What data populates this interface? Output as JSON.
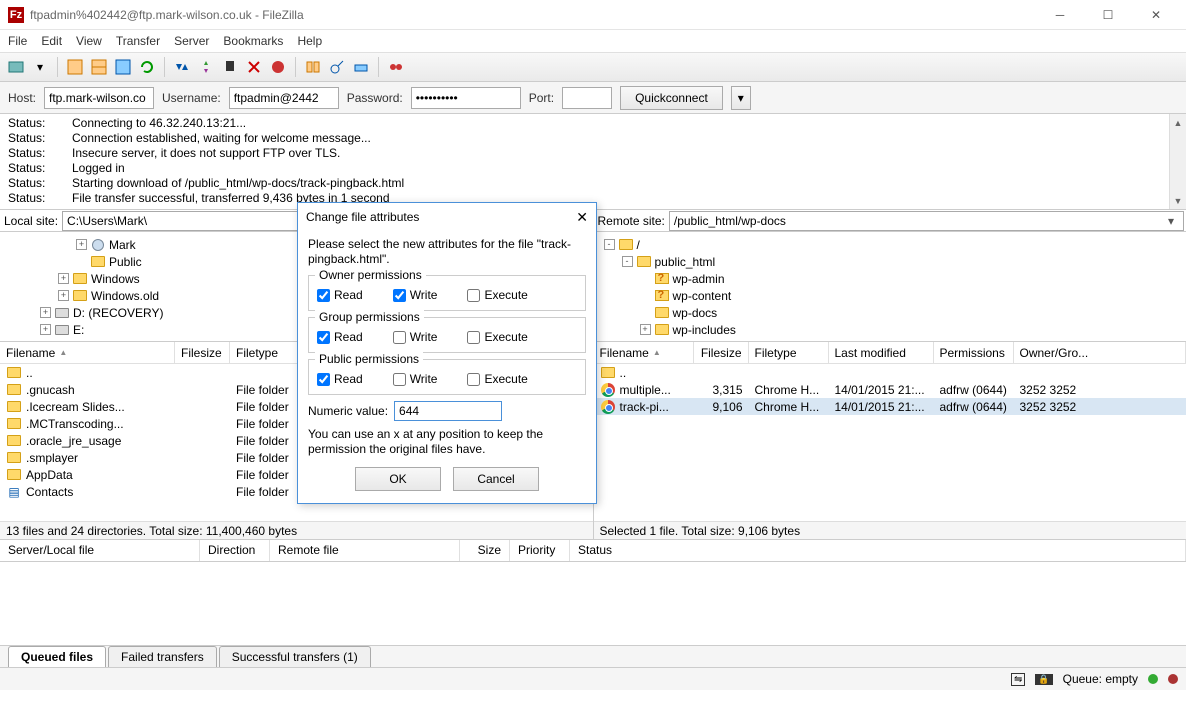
{
  "window": {
    "title": "ftpadmin%402442@ftp.mark-wilson.co.uk - FileZilla"
  },
  "menu": [
    "File",
    "Edit",
    "View",
    "Transfer",
    "Server",
    "Bookmarks",
    "Help"
  ],
  "conn": {
    "host_label": "Host:",
    "host": "ftp.mark-wilson.co",
    "user_label": "Username:",
    "user": "ftpadmin@2442",
    "pass_label": "Password:",
    "pass": "••••••••••",
    "port_label": "Port:",
    "port": "",
    "quick": "Quickconnect"
  },
  "log": [
    {
      "l": "Status:",
      "m": "Connecting to 46.32.240.13:21..."
    },
    {
      "l": "Status:",
      "m": "Connection established, waiting for welcome message..."
    },
    {
      "l": "Status:",
      "m": "Insecure server, it does not support FTP over TLS."
    },
    {
      "l": "Status:",
      "m": "Logged in"
    },
    {
      "l": "Status:",
      "m": "Starting download of /public_html/wp-docs/track-pingback.html"
    },
    {
      "l": "Status:",
      "m": "File transfer successful, transferred 9,436 bytes in 1 second"
    }
  ],
  "local": {
    "site_label": "Local site:",
    "site": "C:\\Users\\Mark\\",
    "tree": [
      {
        "indent": 74,
        "exp": "+",
        "icon": "user",
        "label": "Mark"
      },
      {
        "indent": 74,
        "exp": "",
        "icon": "folder",
        "label": "Public"
      },
      {
        "indent": 56,
        "exp": "+",
        "icon": "folder",
        "label": "Windows"
      },
      {
        "indent": 56,
        "exp": "+",
        "icon": "folder",
        "label": "Windows.old"
      },
      {
        "indent": 38,
        "exp": "+",
        "icon": "drive",
        "label": "D: (RECOVERY)"
      },
      {
        "indent": 38,
        "exp": "+",
        "icon": "drive",
        "label": "E:"
      }
    ],
    "cols": [
      "Filename",
      "Filesize",
      "Filetype"
    ],
    "rows": [
      {
        "name": "..",
        "type": "",
        "icon": "folder"
      },
      {
        "name": ".gnucash",
        "type": "File folder",
        "icon": "folder"
      },
      {
        "name": ".Icecream Slides...",
        "type": "File folder",
        "icon": "folder"
      },
      {
        "name": ".MCTranscoding...",
        "type": "File folder",
        "icon": "folder"
      },
      {
        "name": ".oracle_jre_usage",
        "type": "File folder",
        "icon": "folder"
      },
      {
        "name": ".smplayer",
        "type": "File folder",
        "icon": "folder"
      },
      {
        "name": "AppData",
        "type": "File folder",
        "icon": "folder"
      },
      {
        "name": "Contacts",
        "type": "File folder",
        "icon": "contacts"
      }
    ],
    "status": "13 files and 24 directories. Total size: 11,400,460 bytes"
  },
  "remote": {
    "site_label": "Remote site:",
    "site": "/public_html/wp-docs",
    "tree": [
      {
        "indent": 8,
        "exp": "-",
        "icon": "folder",
        "label": "/"
      },
      {
        "indent": 26,
        "exp": "-",
        "icon": "folder",
        "label": "public_html"
      },
      {
        "indent": 44,
        "exp": "",
        "icon": "q",
        "label": "wp-admin"
      },
      {
        "indent": 44,
        "exp": "",
        "icon": "q",
        "label": "wp-content"
      },
      {
        "indent": 44,
        "exp": "",
        "icon": "folder",
        "label": "wp-docs"
      },
      {
        "indent": 44,
        "exp": "+",
        "icon": "folder",
        "label": "wp-includes"
      }
    ],
    "cols": [
      "Filename",
      "Filesize",
      "Filetype",
      "Last modified",
      "Permissions",
      "Owner/Gro..."
    ],
    "rows": [
      {
        "name": "..",
        "size": "",
        "type": "",
        "mod": "",
        "perm": "",
        "own": "",
        "icon": "folder"
      },
      {
        "name": "multiple...",
        "size": "3,315",
        "type": "Chrome H...",
        "mod": "14/01/2015 21:...",
        "perm": "adfrw (0644)",
        "own": "3252 3252",
        "icon": "chrome"
      },
      {
        "name": "track-pi...",
        "size": "9,106",
        "type": "Chrome H...",
        "mod": "14/01/2015 21:...",
        "perm": "adfrw (0644)",
        "own": "3252 3252",
        "icon": "chrome",
        "sel": true
      }
    ],
    "status": "Selected 1 file. Total size: 9,106 bytes"
  },
  "queue": {
    "cols": [
      "Server/Local file",
      "Direction",
      "Remote file",
      "Size",
      "Priority",
      "Status"
    ],
    "tabs": [
      "Queued files",
      "Failed transfers",
      "Successful transfers (1)"
    ]
  },
  "bottom": {
    "queue": "Queue: empty"
  },
  "dialog": {
    "title": "Change file attributes",
    "intro": "Please select the new attributes for the file \"track-pingback.html\".",
    "groups": [
      {
        "title": "Owner permissions",
        "read": true,
        "write": true,
        "exec": false
      },
      {
        "title": "Group permissions",
        "read": true,
        "write": false,
        "exec": false
      },
      {
        "title": "Public permissions",
        "read": true,
        "write": false,
        "exec": false
      }
    ],
    "labels": {
      "read": "Read",
      "write": "Write",
      "exec": "Execute"
    },
    "numeric_label": "Numeric value:",
    "numeric": "644",
    "hint": "You can use an x at any position to keep the permission the original files have.",
    "ok": "OK",
    "cancel": "Cancel"
  }
}
